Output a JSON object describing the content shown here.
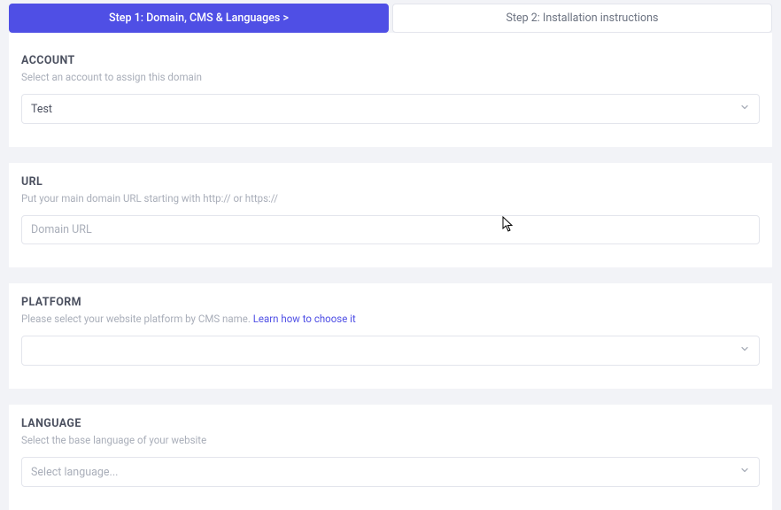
{
  "tabs": {
    "step1": "Step 1: Domain, CMS & Languages  >",
    "step2": "Step 2: Installation instructions"
  },
  "account": {
    "title": "ACCOUNT",
    "desc": "Select an account to assign this domain",
    "value": "Test"
  },
  "url": {
    "title": "URL",
    "desc": "Put your main domain URL starting with http:// or https://",
    "placeholder": "Domain URL"
  },
  "platform": {
    "title": "PLATFORM",
    "desc": "Please select your website platform by CMS name.  ",
    "learn_link": "Learn how to choose it",
    "value": ""
  },
  "language": {
    "title": "LANGUAGE",
    "desc": "Select the base language of your website",
    "placeholder": "Select language..."
  }
}
